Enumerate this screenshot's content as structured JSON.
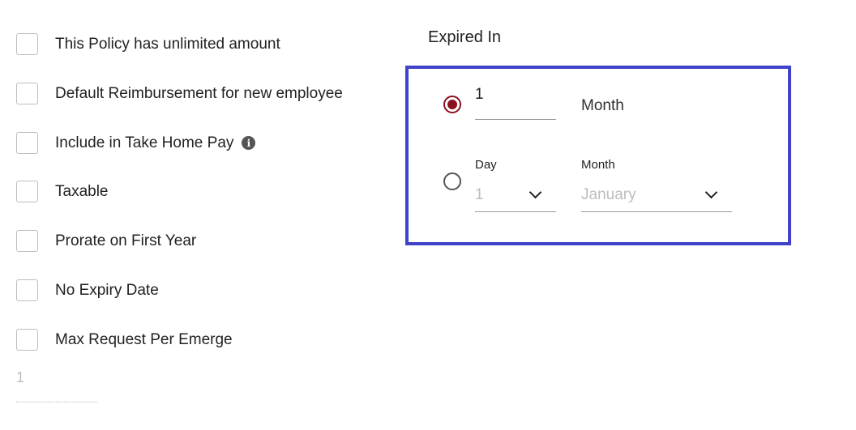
{
  "options": [
    {
      "label": "This Policy has unlimited amount"
    },
    {
      "label": "Default Reimbursement for new employee"
    },
    {
      "label": "Include in Take Home Pay",
      "info_icon": "info-icon"
    },
    {
      "label": "Taxable"
    },
    {
      "label": "Prorate on First Year"
    },
    {
      "label": "No Expiry Date"
    },
    {
      "label": "Max Request Per Emerge"
    }
  ],
  "max_request_value": "1",
  "expired_in": {
    "title": "Expired In",
    "option_duration": {
      "selected": true,
      "value": "1",
      "unit_label": "Month"
    },
    "option_date": {
      "selected": false,
      "day_label": "Day",
      "day_value": "1",
      "month_label": "Month",
      "month_value": "January"
    }
  },
  "colors": {
    "accent": "#8b1020",
    "highlight_border": "#4043c9"
  }
}
